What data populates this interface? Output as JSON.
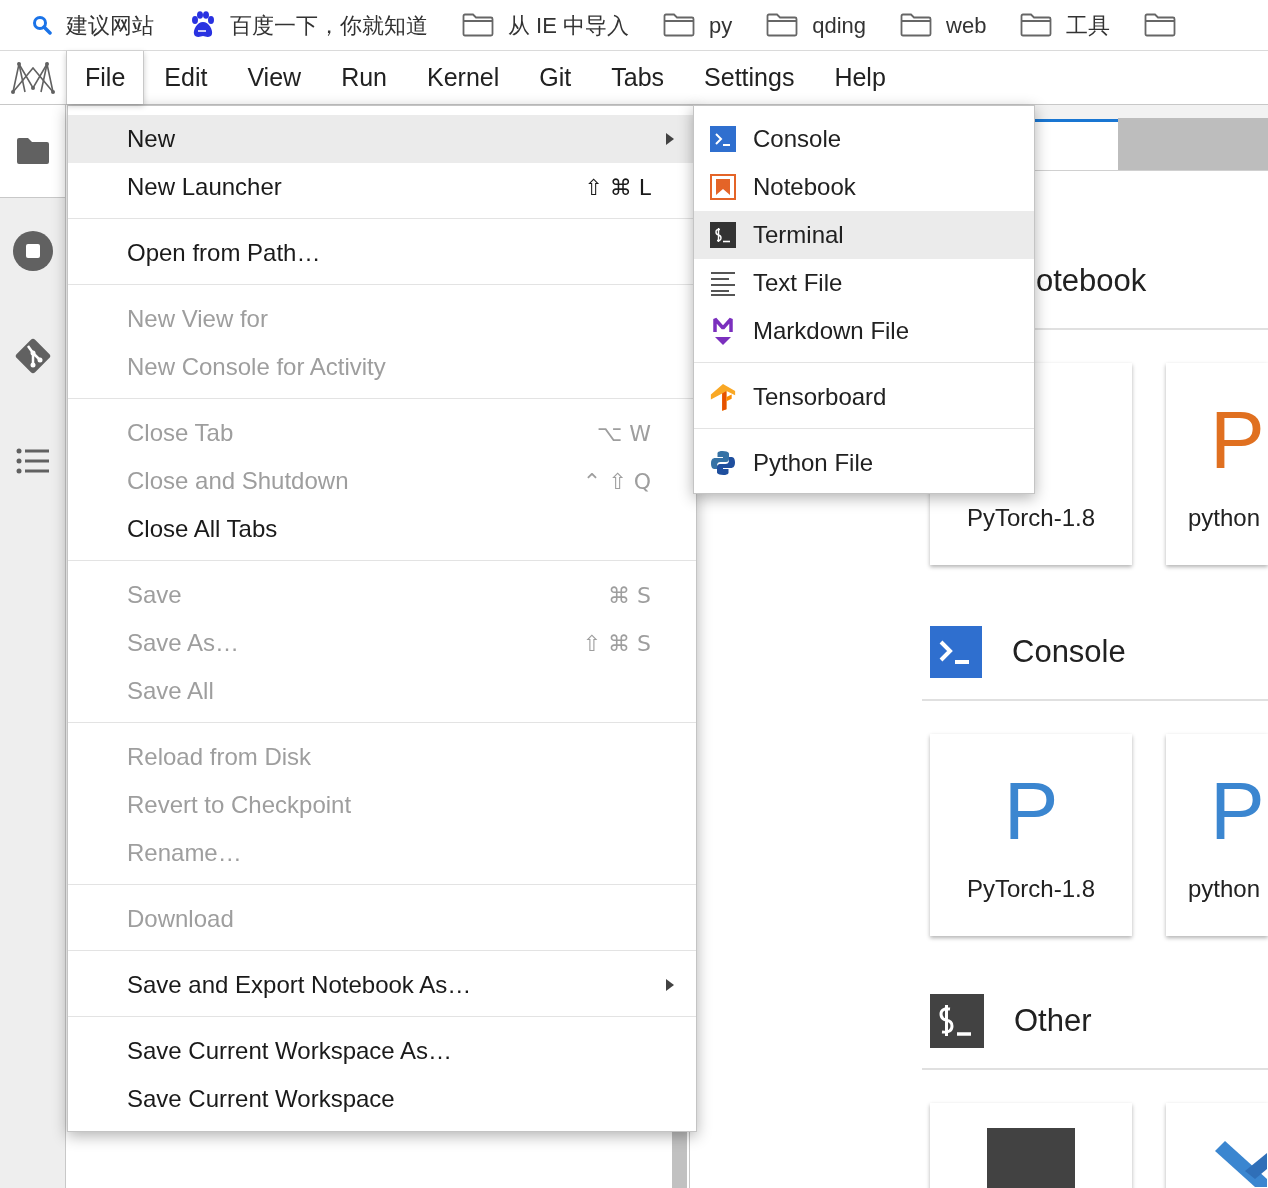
{
  "bookmarks": [
    {
      "kind": "search",
      "label": "建议网站"
    },
    {
      "kind": "paw",
      "label": "百度一下，你就知道"
    },
    {
      "kind": "folder",
      "label": "从 IE 中导入"
    },
    {
      "kind": "folder",
      "label": "py"
    },
    {
      "kind": "folder",
      "label": "qding"
    },
    {
      "kind": "folder",
      "label": "web"
    },
    {
      "kind": "folder",
      "label": "工具"
    },
    {
      "kind": "folder"
    }
  ],
  "menubar": [
    {
      "label": "File",
      "selected": true
    },
    {
      "label": "Edit",
      "selected": false
    },
    {
      "label": "View",
      "selected": false
    },
    {
      "label": "Run",
      "selected": false
    },
    {
      "label": "Kernel",
      "selected": false
    },
    {
      "label": "Git",
      "selected": false
    },
    {
      "label": "Tabs",
      "selected": false
    },
    {
      "label": "Settings",
      "selected": false
    },
    {
      "label": "Help",
      "selected": false
    }
  ],
  "sidebar": [
    {
      "kind": "folder",
      "selected": true
    },
    {
      "kind": "stop",
      "selected": false
    },
    {
      "kind": "git",
      "selected": false
    },
    {
      "kind": "list",
      "selected": false
    }
  ],
  "file_menu": {
    "sections": [
      [
        {
          "label": "New",
          "submenu": true,
          "disabled": false,
          "selected": true
        },
        {
          "label": "New Launcher",
          "shortcut": "⇧ ⌘ L",
          "submenu": false,
          "disabled": false,
          "selected": false
        }
      ],
      [
        {
          "label": "Open from Path…",
          "submenu": false,
          "disabled": false,
          "selected": false
        }
      ],
      [
        {
          "label": "New View for",
          "submenu": false,
          "disabled": true,
          "selected": false
        },
        {
          "label": "New Console for Activity",
          "submenu": false,
          "disabled": true,
          "selected": false
        }
      ],
      [
        {
          "label": "Close Tab",
          "shortcut": "⌥ W",
          "submenu": false,
          "disabled": true,
          "selected": false
        },
        {
          "label": "Close and Shutdown",
          "shortcut": "⌃ ⇧ Q",
          "submenu": false,
          "disabled": true,
          "selected": false
        },
        {
          "label": "Close All Tabs",
          "submenu": false,
          "disabled": false,
          "selected": false
        }
      ],
      [
        {
          "label": "Save",
          "shortcut": "⌘ S",
          "submenu": false,
          "disabled": true,
          "selected": false
        },
        {
          "label": "Save As…",
          "shortcut": "⇧ ⌘ S",
          "submenu": false,
          "disabled": true,
          "selected": false
        },
        {
          "label": "Save All",
          "submenu": false,
          "disabled": true,
          "selected": false
        }
      ],
      [
        {
          "label": "Reload from Disk",
          "submenu": false,
          "disabled": true,
          "selected": false
        },
        {
          "label": "Revert to Checkpoint",
          "submenu": false,
          "disabled": true,
          "selected": false
        },
        {
          "label": "Rename…",
          "submenu": false,
          "disabled": true,
          "selected": false
        }
      ],
      [
        {
          "label": "Download",
          "submenu": false,
          "disabled": true,
          "selected": false
        }
      ],
      [
        {
          "label": "Save and Export Notebook As…",
          "submenu": true,
          "disabled": false,
          "selected": false
        }
      ],
      [
        {
          "label": "Save Current Workspace As…",
          "submenu": false,
          "disabled": false,
          "selected": false
        },
        {
          "label": "Save Current Workspace",
          "submenu": false,
          "disabled": false,
          "selected": false
        }
      ]
    ]
  },
  "new_submenu": {
    "sections": [
      [
        {
          "kind": "console",
          "label": "Console",
          "selected": false
        },
        {
          "kind": "notebook",
          "label": "Notebook",
          "selected": false
        },
        {
          "kind": "terminal",
          "label": "Terminal",
          "selected": true
        },
        {
          "kind": "text",
          "label": "Text File",
          "selected": false
        },
        {
          "kind": "markdown",
          "label": "Markdown File",
          "selected": false
        }
      ],
      [
        {
          "kind": "tensorboard",
          "label": "Tensorboard",
          "selected": false
        }
      ],
      [
        {
          "kind": "python",
          "label": "Python File",
          "selected": false
        }
      ]
    ]
  },
  "launcher": {
    "sections": [
      {
        "heading": "otebook",
        "cards": [
          {
            "label": "PyTorch-1.8"
          },
          {
            "logo": "P",
            "color": "#e07020",
            "label": "python"
          }
        ]
      },
      {
        "kind": "console",
        "heading": "Console",
        "cards": [
          {
            "logo": "P",
            "color": "#3b86d0",
            "label": "PyTorch-1.8"
          },
          {
            "logo": "P",
            "color": "#3b86d0",
            "label": "python"
          }
        ]
      },
      {
        "kind": "terminal",
        "heading": "Other",
        "cards": [
          {
            "kind": "terminal"
          },
          {
            "kind": "cross"
          }
        ]
      }
    ]
  }
}
